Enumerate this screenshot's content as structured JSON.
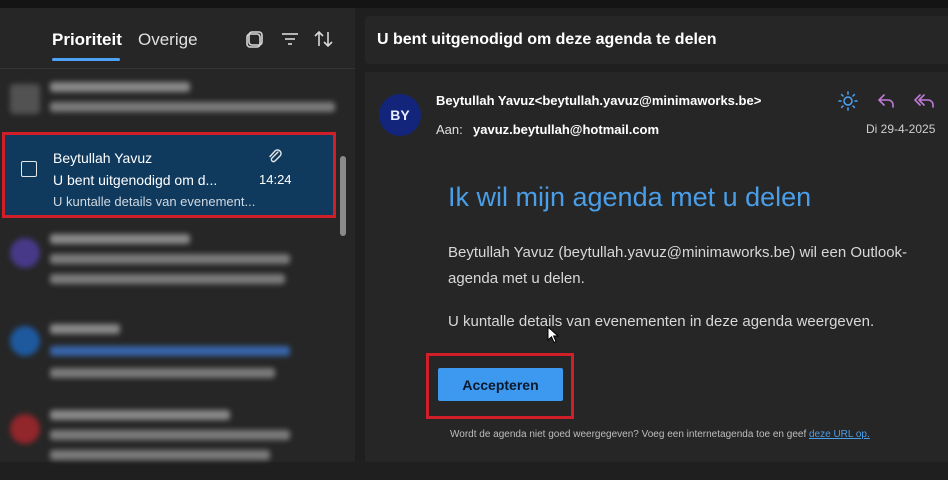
{
  "tabs": {
    "priority": "Prioriteit",
    "other": "Overige"
  },
  "colors": {
    "accent": "#4fa3f7",
    "selected_bg": "#0f3a5e",
    "highlight_red": "#d11f2a",
    "avatar_bg": "#13257a",
    "accept_btn": "#3d98f0"
  },
  "toolbar_icons": [
    "select-all-icon",
    "filter-icon",
    "sort-icon"
  ],
  "selected_message": {
    "sender": "Beytullah Yavuz",
    "subject": "U bent uitgenodigd om d...",
    "time": "14:24",
    "preview": "U kuntalle details van evenement...",
    "attachment_icon": "paperclip-icon"
  },
  "email": {
    "subject": "U bent uitgenodigd om deze agenda te delen",
    "avatar_initials": "BY",
    "from": "Beytullah Yavuz<beytullah.yavuz@minimaworks.be>",
    "to_label": "Aan:",
    "to": "yavuz.beytullah@hotmail.com",
    "date": "Di 29-4-2025",
    "action_icons": [
      "sun-icon",
      "reply-icon",
      "reply-all-icon"
    ],
    "heading": "Ik wil mijn agenda met u delen",
    "paragraph1": "Beytullah Yavuz (beytullah.yavuz@minimaworks.be) wil een Outlook-agenda met u delen.",
    "paragraph2": "U kuntalle details van evenementen in deze agenda weergeven.",
    "accept_label": "Accepteren",
    "footer_text": "Wordt de agenda niet goed weergegeven? Voeg een internetagenda toe en geef ",
    "footer_link": "deze URL op."
  }
}
